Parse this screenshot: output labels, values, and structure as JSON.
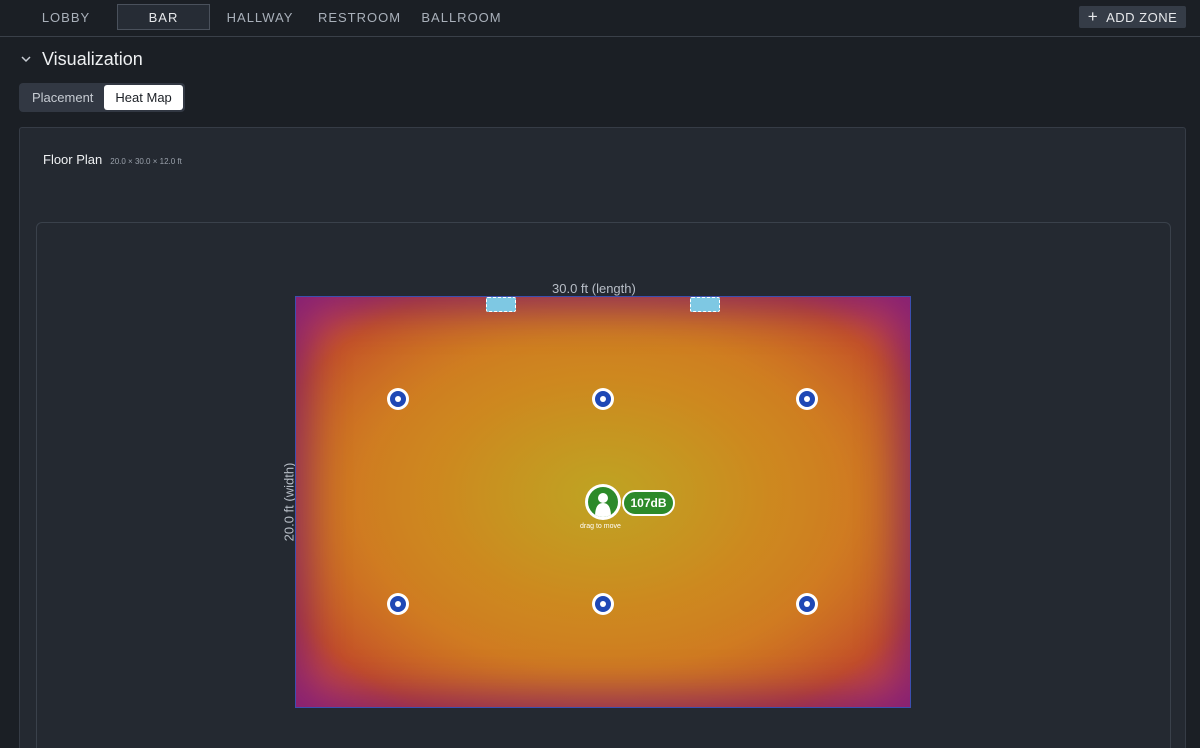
{
  "zones": {
    "tabs": [
      {
        "label": "LOBBY"
      },
      {
        "label": "BAR"
      },
      {
        "label": "HALLWAY"
      },
      {
        "label": "RESTROOM"
      },
      {
        "label": "BALLROOM"
      }
    ],
    "active": "BAR",
    "add_label": "ADD ZONE"
  },
  "section": {
    "title": "Visualization"
  },
  "view_toggle": {
    "options": [
      {
        "label": "Placement"
      },
      {
        "label": "Heat Map"
      }
    ],
    "selected": "Heat Map"
  },
  "floor_plan": {
    "title": "Floor Plan",
    "dimensions": "20.0 × 30.0 × 12.0 ft",
    "length_label": "30.0 ft (length)",
    "width_label": "20.0 ft (width)"
  },
  "listener": {
    "level": "107dB",
    "hint": "drag to move"
  },
  "colors": {
    "background": "#1b1f25",
    "panel": "#242931",
    "speaker": "#1f48b5",
    "listener": "#2d8a2a",
    "sensor": "#7ec8e3",
    "heat_high": "#c8a825",
    "heat_mid": "#d26a24",
    "heat_low": "#a8308a"
  }
}
